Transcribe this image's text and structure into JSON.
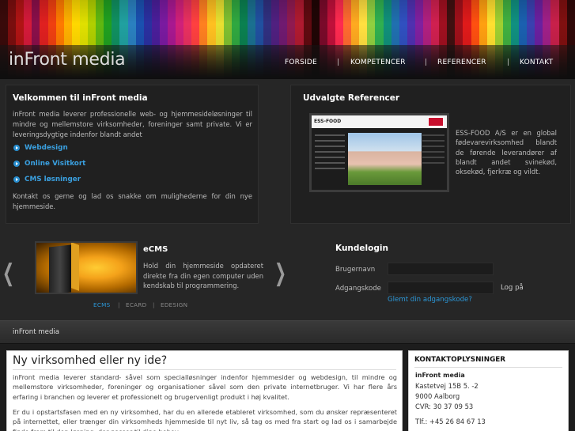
{
  "header": {
    "logo": "inFront media",
    "nav": [
      {
        "label": "FORSIDE"
      },
      {
        "label": "KOMPETENCER"
      },
      {
        "label": "REFERENCER"
      },
      {
        "label": "KONTAKT"
      }
    ],
    "separator": "|",
    "stripe_colors": [
      "#3a0a0a",
      "#7a0e0e",
      "#b01414",
      "#d41a3a",
      "#8a0f4a",
      "#e02020",
      "#f04010",
      "#ff7a00",
      "#ffb000",
      "#ffd800",
      "#e0e000",
      "#b0d000",
      "#60b810",
      "#20a020",
      "#109060",
      "#20a0a0",
      "#2a80c0",
      "#1a50b0",
      "#2a30a0",
      "#4a1e9a",
      "#7a1aa0",
      "#a81890",
      "#d0207a",
      "#e83060",
      "#ff4040",
      "#ff8020",
      "#ffc020",
      "#e8e030",
      "#80c030",
      "#30a840",
      "#0a8050",
      "#1a7090",
      "#2050a0",
      "#303080",
      "#502080",
      "#701a70",
      "#901a50",
      "#b01a30",
      "#600a10",
      "#200505",
      "#7a0a2a",
      "#c0103a",
      "#ff2a50",
      "#ff6a30",
      "#ffaa20",
      "#ffe040",
      "#90d040",
      "#30b050",
      "#10907a",
      "#2070b0",
      "#3050c0",
      "#5030b0",
      "#8020a0",
      "#b02080",
      "#d02050",
      "#a01020",
      "#401010",
      "#a0101a",
      "#e01a1a",
      "#ff5010",
      "#ffa010",
      "#ffe030",
      "#a0d030",
      "#40b040",
      "#109080",
      "#1a60b0",
      "#3a40b0",
      "#6a20a0",
      "#a02088",
      "#c8204a",
      "#801010",
      "#300808"
    ]
  },
  "intro": {
    "title": "Velkommen til inFront media",
    "text": "inFront media leverer professionelle web- og hjemmesideløsninger til mindre og mellemstore virksomheder, foreninger samt private. Vi er leveringsdygtige indenfor blandt andet",
    "links": [
      {
        "label": "Webdesign"
      },
      {
        "label": "Online Visitkort"
      },
      {
        "label": "CMS løsninger"
      }
    ],
    "outro": "Kontakt os gerne og lad os snakke om mulighederne for din nye hjemmeside."
  },
  "references": {
    "title": "Udvalgte Referencer",
    "logo_text": "ESS-FOOD",
    "text": "ESS-FOOD A/S er en global fødevarevirksomhed blandt de førende leverandører af blandt andet svinekød, oksekød, fjerkræ og vildt."
  },
  "slider": {
    "prev": "❮",
    "next": "❯",
    "title": "eCMS",
    "text": "Hold din hjemmeside opdateret direkte fra din egen computer uden kendskab til programmering.",
    "tabs": [
      {
        "label": "ECMS",
        "active": true
      },
      {
        "label": "ECARD",
        "active": false
      },
      {
        "label": "EDESIGN",
        "active": false
      }
    ],
    "separator": "|"
  },
  "login": {
    "title": "Kundelogin",
    "username_label": "Brugernavn",
    "password_label": "Adgangskode",
    "submit_label": "Log på",
    "forgot_label": "Glemt din adgangskode?"
  },
  "strip": {
    "label": "inFront media"
  },
  "main": {
    "heading": "Ny virksomhed eller ny ide?",
    "para1": "inFront media leverer standard- såvel som specialløsninger indenfor hjemmesider og webdesign, til mindre og mellemstore virksomheder, foreninger og organisationer såvel som den private internetbruger. Vi har flere års erfaring i branchen og leverer et professionelt og brugervenligt produkt i høj kvalitet.",
    "para2": "Er du i opstartsfasen med en ny virksomhed, har du en allerede etableret virksomhed, som du ønsker repræsenteret på internettet, eller trænger din virksomheds hjemmeside til nyt liv, så tag os med fra start og lad os i samarbejde finde frem til den løsning, der passer til dine behov."
  },
  "contact": {
    "title": "KONTAKTOPLYSNINGER",
    "company": "inFront media",
    "address": "Kastetvej 15B 5. -2",
    "city": "9000 Aalborg",
    "cvr": "CVR: 30 37 09 53",
    "phone": "Tlf.: +45 26 84 67 13"
  }
}
